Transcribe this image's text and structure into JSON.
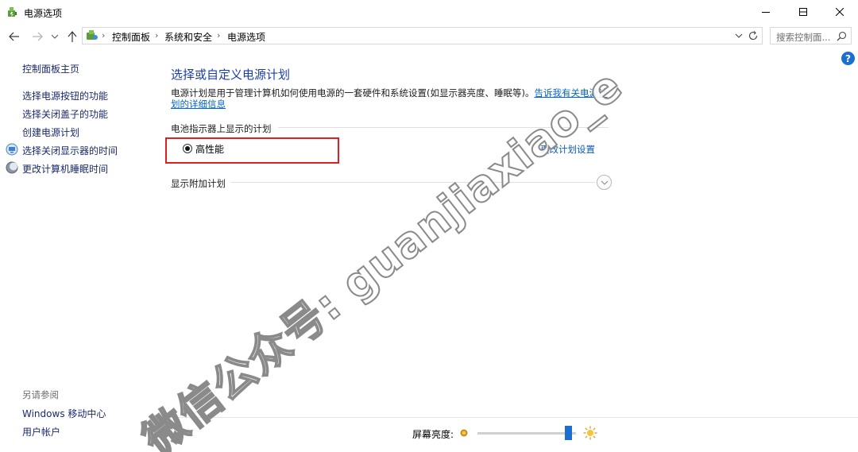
{
  "window": {
    "title": "电源选项",
    "controls": [
      "minimize",
      "maximize",
      "close"
    ]
  },
  "address_bar": {
    "breadcrumbs": [
      "控制面板",
      "系统和安全",
      "电源选项"
    ],
    "search_placeholder": "搜索控制面..."
  },
  "sidebar": {
    "home_link": "控制面板主页",
    "items": [
      {
        "label": "选择电源按钮的功能",
        "icon": ""
      },
      {
        "label": "选择关闭盖子的功能",
        "icon": ""
      },
      {
        "label": "创建电源计划",
        "icon": ""
      },
      {
        "label": "选择关闭显示器的时间",
        "icon": "display-icon"
      },
      {
        "label": "更改计算机睡眠时间",
        "icon": "moon-icon"
      }
    ],
    "see_also_label": "另请参阅",
    "see_also_links": [
      "Windows 移动中心",
      "用户帐户"
    ]
  },
  "main": {
    "heading": "选择或自定义电源计划",
    "description": "电源计划是用于管理计算机如何使用电源的一套硬件和系统设置(如显示器亮度、睡眠等)。",
    "description_link": "告诉我有关电源计划的详细信息",
    "battery_section_label": "电池指示器上显示的计划",
    "plans": [
      {
        "name": "高性能",
        "selected": true,
        "change_link": "更改计划设置"
      }
    ],
    "additional_plans_label": "显示附加计划"
  },
  "bottom": {
    "brightness_label": "屏幕亮度:",
    "brightness_value": 0.92
  },
  "watermark": "微信公众号: guanjiaxiao_e",
  "colors": {
    "link": "#1a2a6e",
    "heading": "#1a3ea8",
    "highlight_box": "#e02020",
    "slider_thumb": "#1a6fd0"
  }
}
